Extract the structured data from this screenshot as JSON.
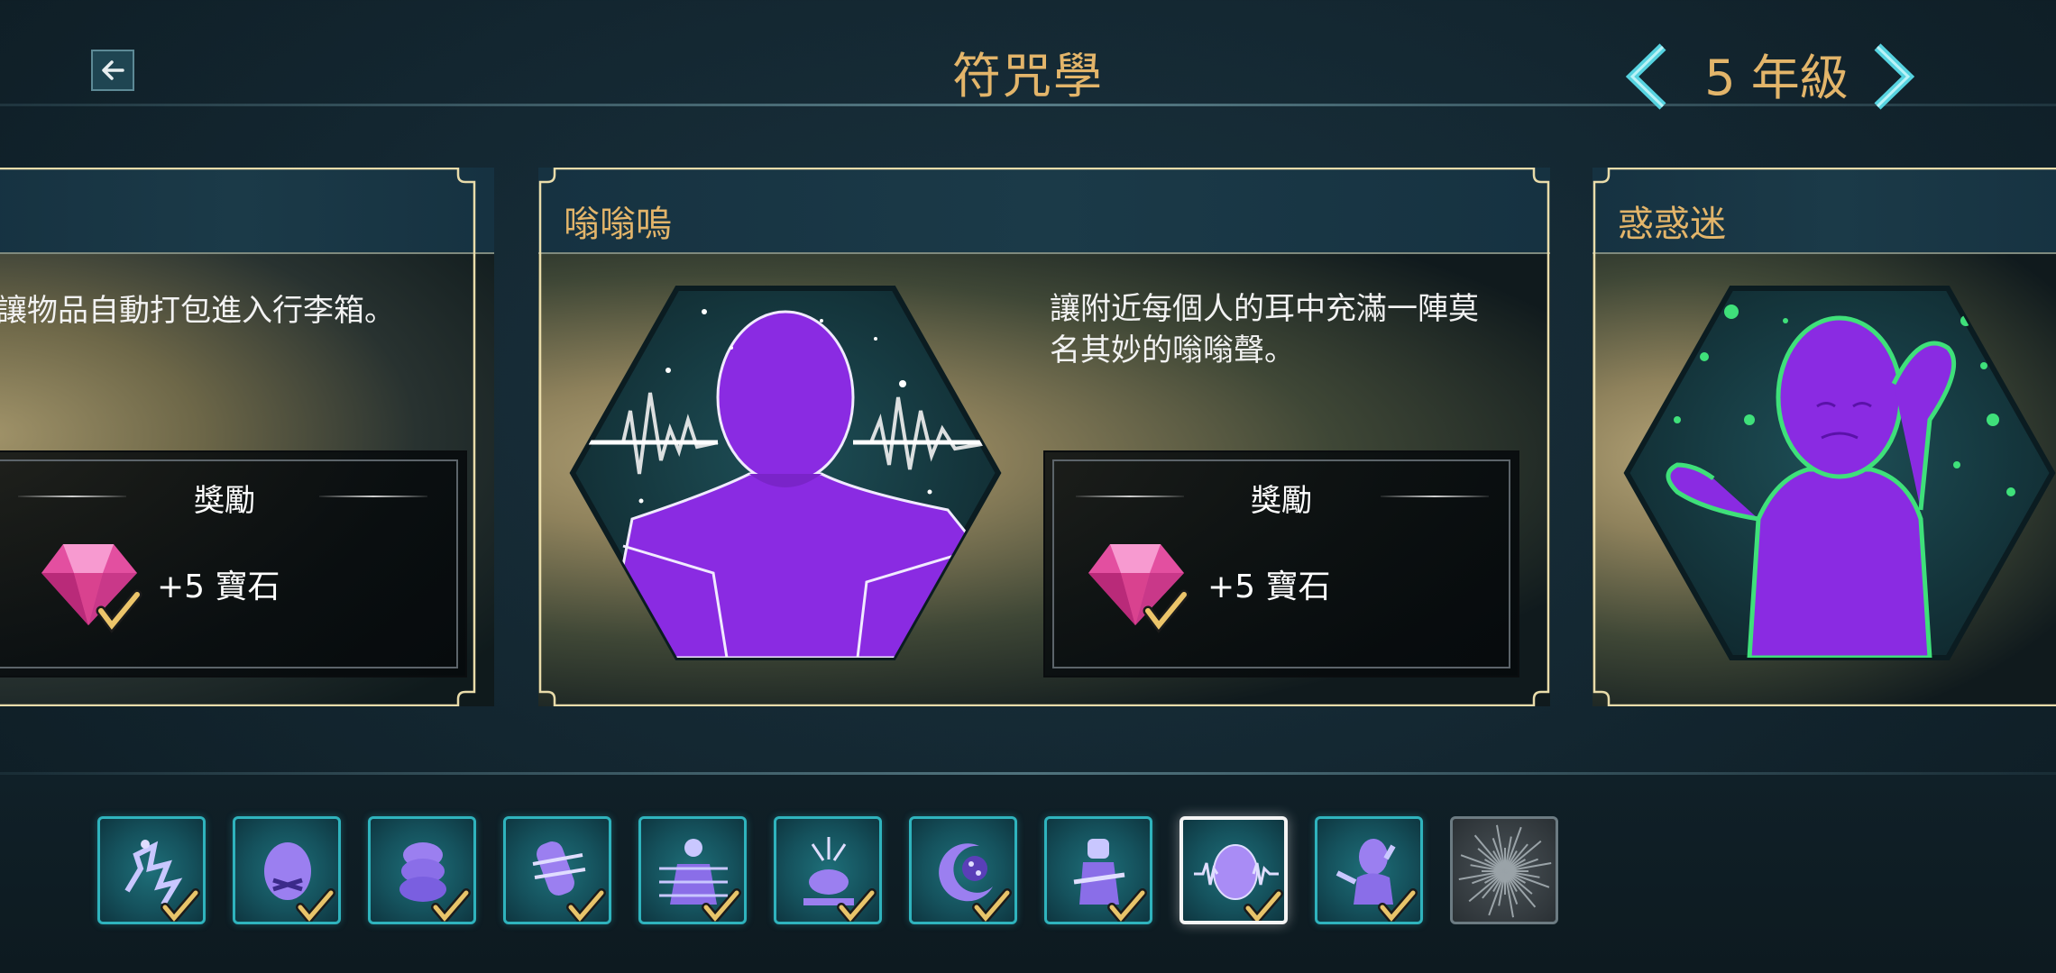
{
  "header": {
    "title": "符咒學",
    "year_label": "5 年級"
  },
  "cards": [
    {
      "title": "",
      "description": "讓物品自動打包進入行李箱。",
      "reward_heading": "獎勵",
      "reward_text": "+5 寶石"
    },
    {
      "title": "嗡嗡嗚",
      "description_lines": [
        "讓附近每個人的耳中充滿一陣莫",
        "名其妙的嗡嗡聲。"
      ],
      "reward_heading": "獎勵",
      "reward_text": "+5 寶石"
    },
    {
      "title": "惑惑迷"
    }
  ],
  "spell_bar": {
    "items": [
      {
        "icon": "scatter-spell-icon",
        "completed": true
      },
      {
        "icon": "silenced-mask-icon",
        "completed": true
      },
      {
        "icon": "stacked-heads-icon",
        "completed": true
      },
      {
        "icon": "wrapped-figure-icon",
        "completed": true
      },
      {
        "icon": "robed-figure-icon",
        "completed": true
      },
      {
        "icon": "impact-figure-icon",
        "completed": true
      },
      {
        "icon": "crescent-orb-icon",
        "completed": true
      },
      {
        "icon": "cloaked-figure-icon",
        "completed": true
      },
      {
        "icon": "buzzing-head-icon",
        "completed": true,
        "selected": true
      },
      {
        "icon": "confused-figure-icon",
        "completed": true
      },
      {
        "icon": "dark-burst-icon",
        "completed": false,
        "locked": true
      }
    ]
  },
  "colors": {
    "accent_gold": "#e3b56a",
    "spell_purple": "#8a2be2",
    "tile_border": "#2fb3bd",
    "check_gold": "#e8c46a"
  }
}
